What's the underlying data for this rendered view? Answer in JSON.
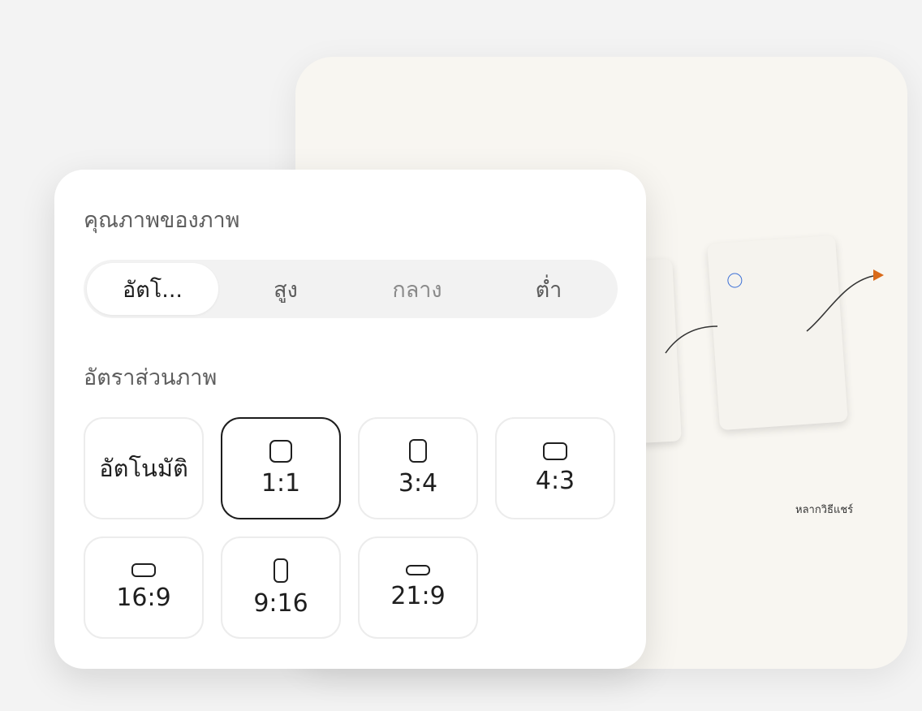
{
  "preview": {
    "caption": "หลากวิธีแชร์",
    "accent_arrow_color": "#d96a1a",
    "card_circle_color": "#3b6fd6"
  },
  "quality": {
    "title": "คุณภาพของภาพ",
    "options": [
      {
        "label": "อัตโ...",
        "selected": true
      },
      {
        "label": "สูง",
        "selected": false
      },
      {
        "label": "กลาง",
        "selected": false
      },
      {
        "label": "ต่ำ",
        "selected": false
      }
    ]
  },
  "aspect": {
    "title": "อัตราส่วนภาพ",
    "options": [
      {
        "label": "อัตโนมัติ",
        "icon": "none",
        "selected": false
      },
      {
        "label": "1:1",
        "icon": "square-icon",
        "selected": true
      },
      {
        "label": "3:4",
        "icon": "portrait-3-4-icon",
        "selected": false
      },
      {
        "label": "4:3",
        "icon": "landscape-4-3-icon",
        "selected": false
      },
      {
        "label": "16:9",
        "icon": "landscape-16-9-icon",
        "selected": false
      },
      {
        "label": "9:16",
        "icon": "portrait-9-16-icon",
        "selected": false
      },
      {
        "label": "21:9",
        "icon": "landscape-21-9-icon",
        "selected": false
      }
    ]
  }
}
